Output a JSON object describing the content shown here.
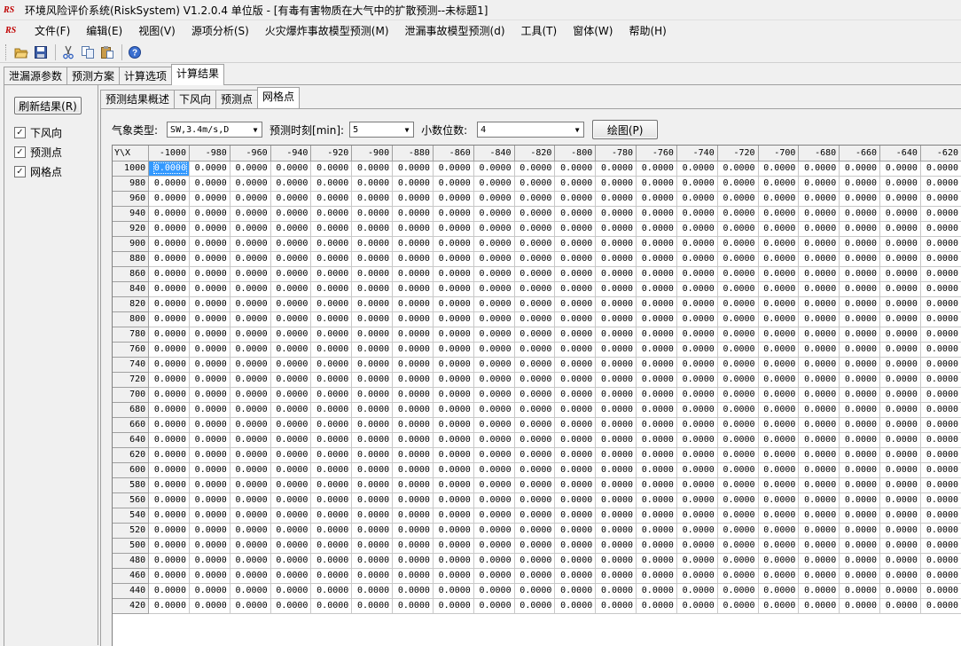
{
  "window": {
    "title": "环境风险评价系统(RiskSystem) V1.2.0.4 单位版 - [有毒有害物质在大气中的扩散预测--未标题1]",
    "logo_text": "RS"
  },
  "menubar": {
    "logo_text": "RS",
    "items": [
      "文件(F)",
      "编辑(E)",
      "视图(V)",
      "源项分析(S)",
      "火灾爆炸事故模型预测(M)",
      "泄漏事故模型预测(d)",
      "工具(T)",
      "窗体(W)",
      "帮助(H)"
    ]
  },
  "toolbar": {
    "icons": [
      "open-folder-icon",
      "save-icon",
      "cut-icon",
      "copy-icon",
      "paste-icon",
      "help-icon"
    ]
  },
  "outer_tabs": [
    "泄漏源参数",
    "预测方案",
    "计算选项",
    "计算结果"
  ],
  "sidebar": {
    "refresh_label": "刷新结果(R)",
    "checkboxes": [
      {
        "label": "下风向",
        "checked": true
      },
      {
        "label": "预测点",
        "checked": true
      },
      {
        "label": "网格点",
        "checked": true
      }
    ]
  },
  "inner_tabs": [
    "预测结果概述",
    "下风向",
    "预测点",
    "网格点"
  ],
  "controls": {
    "weather_label": "气象类型:",
    "weather_value": "SW,3.4m/s,D",
    "time_label": "预测时刻[min]:",
    "time_value": "5",
    "decimals_label": "小数位数:",
    "decimals_value": "4",
    "draw_label": "绘图(P)"
  },
  "grid": {
    "corner": "Y\\X",
    "x_headers": [
      "-1000",
      "-980",
      "-960",
      "-940",
      "-920",
      "-900",
      "-880",
      "-860",
      "-840",
      "-820",
      "-800",
      "-780",
      "-760",
      "-740",
      "-720",
      "-700",
      "-680",
      "-660",
      "-640",
      "-620"
    ],
    "y_headers": [
      "1000",
      "980",
      "960",
      "940",
      "920",
      "900",
      "880",
      "860",
      "840",
      "820",
      "800",
      "780",
      "760",
      "740",
      "720",
      "700",
      "680",
      "660",
      "640",
      "620",
      "600",
      "580",
      "560",
      "540",
      "520",
      "500",
      "480",
      "460",
      "440",
      "420"
    ],
    "cell_value": "0.0000",
    "selected_cell": [
      0,
      0
    ]
  }
}
